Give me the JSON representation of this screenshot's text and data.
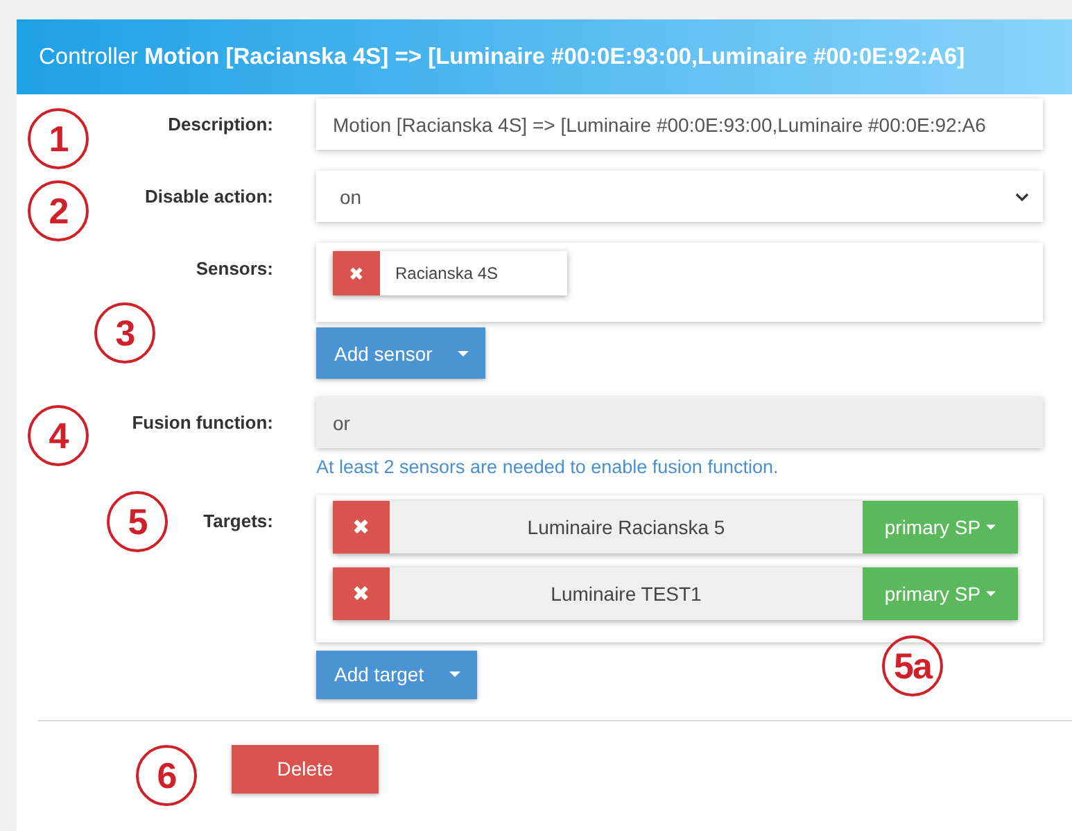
{
  "header": {
    "title": "Controller **Motion [Racianska 4S] => [Luminaire #00:0E:93:00,Luminaire #00:0E:92:A6]**"
  },
  "description": {
    "label": "Description:",
    "value": "Motion [Racianska 4S] => [Luminaire #00:0E:93:00,Luminaire #00:0E:92:A6"
  },
  "disable_action": {
    "label": "Disable action:",
    "value": "on"
  },
  "sensors": {
    "label": "Sensors:",
    "items": [
      {
        "name": "Racianska 4S",
        "remove": "✖"
      }
    ],
    "add_button": "Add sensor"
  },
  "fusion_function": {
    "label": "Fusion function:",
    "value": "or",
    "disabled": true,
    "help": "At least 2 sensors are needed to enable fusion function."
  },
  "targets": {
    "label": "Targets:",
    "items": [
      {
        "name": "Luminaire Racianska 5",
        "remove": "✖",
        "mode": "primary SP"
      },
      {
        "name": "Luminaire TEST1",
        "remove": "✖",
        "mode": "primary SP"
      }
    ],
    "add_button": "Add target"
  },
  "delete_button": "Delete",
  "annotations": [
    "1",
    "2",
    "3",
    "4",
    "5",
    "5a",
    "6"
  ]
}
